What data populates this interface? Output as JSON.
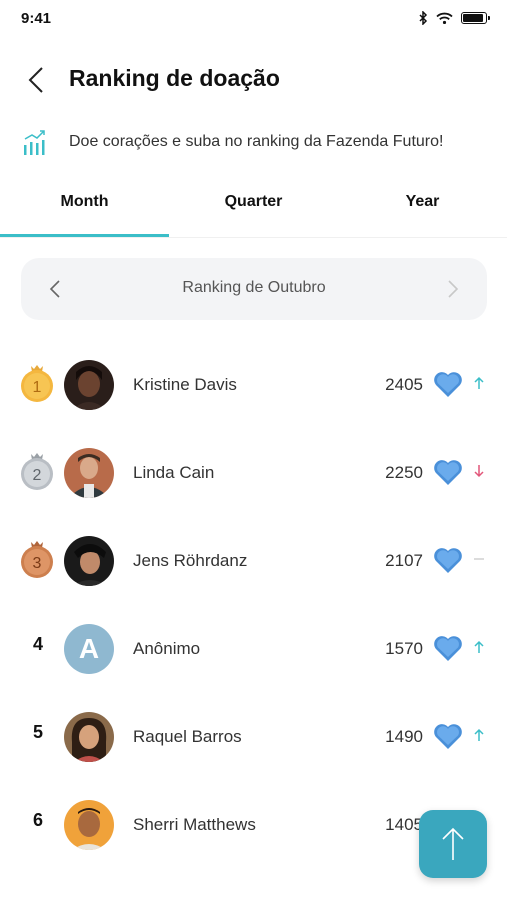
{
  "status_bar": {
    "time": "9:41"
  },
  "header": {
    "title": "Ranking de doação"
  },
  "promo": {
    "text": "Doe corações e suba no ranking da Fazenda Futuro!"
  },
  "tabs": [
    {
      "label": "Month",
      "active": true
    },
    {
      "label": "Quarter",
      "active": false
    },
    {
      "label": "Year",
      "active": false
    }
  ],
  "period": {
    "label": "Ranking de Outubro"
  },
  "ranking": [
    {
      "rank": "1",
      "name": "Kristine Davis",
      "score": "2405",
      "trend": "up",
      "medal": "gold"
    },
    {
      "rank": "2",
      "name": "Linda Cain",
      "score": "2250",
      "trend": "down",
      "medal": "silver"
    },
    {
      "rank": "3",
      "name": "Jens Röhrdanz",
      "score": "2107",
      "trend": "same",
      "medal": "bronze"
    },
    {
      "rank": "4",
      "name": "Anônimo",
      "score": "1570",
      "trend": "up",
      "avatar_letter": "A"
    },
    {
      "rank": "5",
      "name": "Raquel Barros",
      "score": "1490",
      "trend": "up"
    },
    {
      "rank": "6",
      "name": "Sherri Matthews",
      "score": "1405",
      "trend": "up"
    }
  ],
  "colors": {
    "accent": "#3bbec8",
    "fab": "#3aa7be",
    "heart": "#4a90d9",
    "trend_up": "#3bbec8",
    "trend_down": "#e2577a"
  }
}
